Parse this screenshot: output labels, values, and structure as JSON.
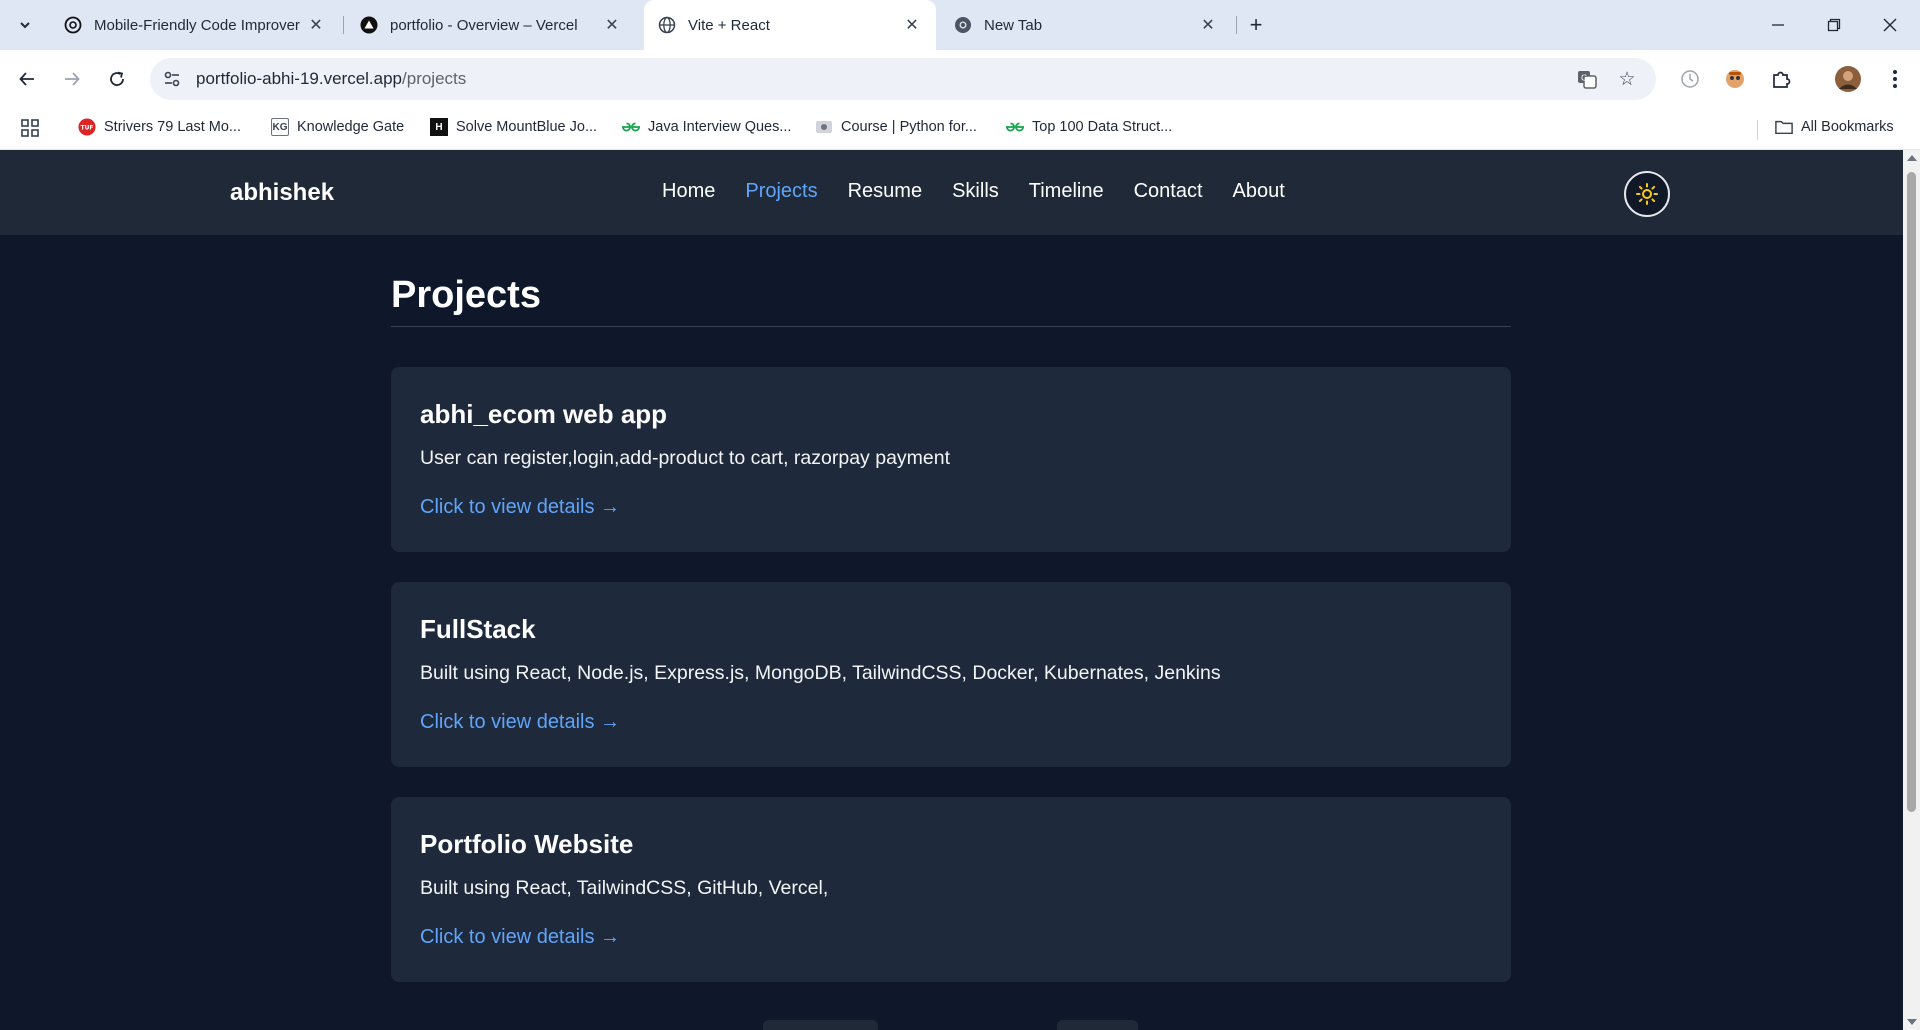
{
  "browser": {
    "tabs": [
      {
        "title": "Mobile-Friendly Code Improver",
        "favicon": "openai-icon"
      },
      {
        "title": "portfolio - Overview – Vercel",
        "favicon": "vercel-icon"
      },
      {
        "title": "Vite + React",
        "favicon": "globe-icon",
        "active": true
      },
      {
        "title": "New Tab",
        "favicon": "chrome-icon"
      }
    ],
    "url_host": "portfolio-abhi-19.vercel.app",
    "url_path": "/projects",
    "bookmarks": [
      {
        "label": "Strivers 79 Last Mo...",
        "icon": "tuf-icon"
      },
      {
        "label": "Knowledge Gate",
        "icon": "kg-icon"
      },
      {
        "label": "Solve MountBlue Jo...",
        "icon": "hackerrank-icon"
      },
      {
        "label": "Java Interview Ques...",
        "icon": "gfg-icon"
      },
      {
        "label": "Course | Python for...",
        "icon": "course-icon"
      },
      {
        "label": "Top 100 Data Struct...",
        "icon": "gfg-icon"
      }
    ],
    "all_bookmarks_label": "All Bookmarks",
    "bookmark_icon_text": {
      "tuf": "TUF",
      "kg": "KG",
      "hr": "H"
    }
  },
  "site": {
    "brand": "abhishek",
    "nav": [
      "Home",
      "Projects",
      "Resume",
      "Skills",
      "Timeline",
      "Contact",
      "About"
    ],
    "active_nav": "Projects",
    "page_title": "Projects",
    "projects": [
      {
        "title": "abhi_ecom web app",
        "description": "User can register,login,add-product to cart, razorpay payment",
        "link": "Click to view details →"
      },
      {
        "title": "FullStack",
        "description": "Built using React, Node.js, Express.js, MongoDB, TailwindCSS, Docker, Kubernates, Jenkins",
        "link": "Click to view details →"
      },
      {
        "title": "Portfolio Website",
        "description": "Built using React, TailwindCSS, GitHub, Vercel,",
        "link": "Click to view details →"
      }
    ]
  },
  "colors": {
    "page_bg": "#0f172a",
    "nav_bg": "#1f2937",
    "card_bg": "#1e293b",
    "accent": "#60a5fa",
    "sun": "#facc15"
  }
}
